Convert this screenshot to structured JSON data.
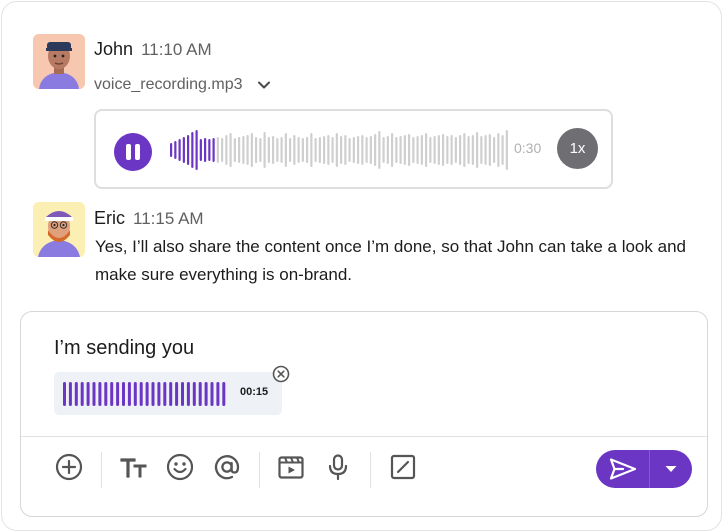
{
  "colors": {
    "accent": "#6b36c4",
    "wave_played": "#6b36c4",
    "wave_unplayed": "#cfcfcf",
    "speed_bg": "#6e6e73",
    "attach_bg": "#eef1f6"
  },
  "messages": [
    {
      "author": "John",
      "time": "11:10 AM",
      "avatar_icon": "john-avatar",
      "attachment": {
        "file_name": "voice_recording.mp3",
        "toggle_icon": "chevron-down-icon",
        "player": {
          "state_icon": "pause-icon",
          "duration": "0:30",
          "speed": "1x",
          "progress": 0.13
        }
      }
    },
    {
      "author": "Eric",
      "time": "11:15 AM",
      "avatar_icon": "eric-avatar",
      "text": "Yes, I’ll also share the content once I’m done, so that John can take a look and make sure everything is on-brand."
    }
  ],
  "composer": {
    "text": "I’m sending you",
    "attachment": {
      "duration": "00:15",
      "remove_icon": "close-circle-icon"
    },
    "toolbar": [
      "plus-circle-icon",
      "text-format-icon",
      "emoji-icon",
      "mention-icon",
      "video-clip-icon",
      "microphone-icon",
      "slash-command-icon"
    ],
    "send_icon": "send-icon",
    "send_options_icon": "caret-down-icon"
  }
}
